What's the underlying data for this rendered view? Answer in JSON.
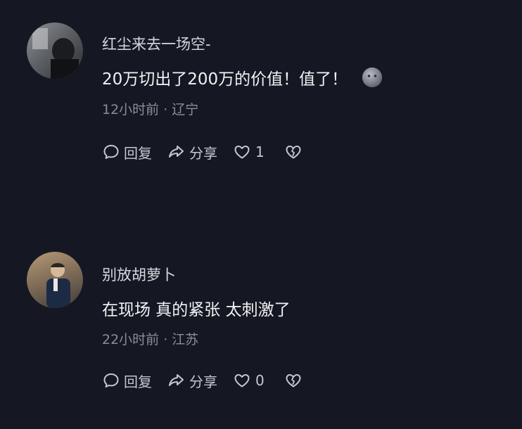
{
  "comments": [
    {
      "username": "红尘来去一场空-",
      "text": "20万切出了200万的价值！值了！",
      "time": "12小时前",
      "location": "辽宁",
      "reply_label": "回复",
      "share_label": "分享",
      "like_count": "1",
      "emoji_icon": "gray-face-emoji"
    },
    {
      "username": "别放胡萝卜",
      "text": "在现场 真的紧张 太刺激了",
      "time": "22小时前",
      "location": "江苏",
      "reply_label": "回复",
      "share_label": "分享",
      "like_count": "0"
    }
  ],
  "separator": "·",
  "colors": {
    "background": "#151822",
    "text": "#f1f2f5",
    "meta": "#8b8e97",
    "actions": "#c5c7cd"
  }
}
